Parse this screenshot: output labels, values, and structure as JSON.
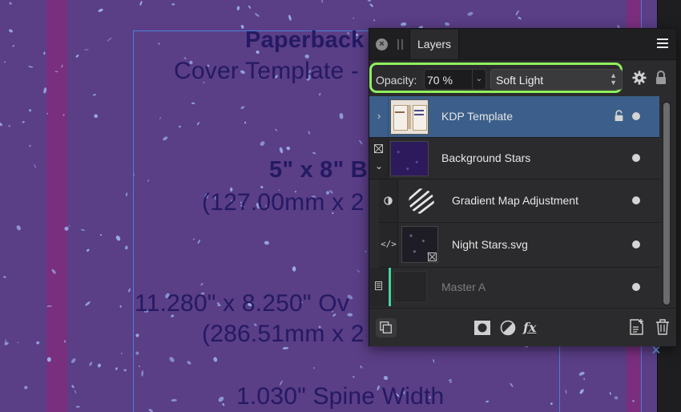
{
  "document": {
    "lines": [
      {
        "id": "title",
        "text": "Paperback"
      },
      {
        "id": "subtitle",
        "text": "Cover Template -"
      },
      {
        "id": "trim",
        "text": "5\" x 8\" B"
      },
      {
        "id": "trim_mm",
        "text": "(127.00mm x 2"
      },
      {
        "id": "overall",
        "text": "11.280\" x 8.250\" Ov"
      },
      {
        "id": "overall_mm",
        "text": "(286.51mm x 2"
      },
      {
        "id": "spine",
        "text": "1.030\" Spine Width"
      }
    ]
  },
  "colors": {
    "canvas": "#5a3e86",
    "bleed": "#7a2f7e",
    "guide": "#4a80d8",
    "star": "#9db3f0",
    "highlight": "#8ff05d",
    "selected_row": "#3b5f8a"
  },
  "panel": {
    "tab_label": "Layers",
    "close_icon": "close-icon",
    "menu_icon": "hamburger-menu-icon",
    "opacity_label": "Opacity:",
    "opacity_value": "70 %",
    "blend_mode": "Soft Light",
    "layers": [
      {
        "name": "KDP Template",
        "selected": true,
        "locked": true,
        "expanded": false,
        "thumbnail": "template-thumbnail"
      },
      {
        "name": "Background Stars",
        "selected": false,
        "locked": false,
        "expanded": true,
        "thumbnail": "stars-thumbnail"
      },
      {
        "name": "Gradient Map Adjustment",
        "selected": false,
        "child": true,
        "thumbnail": "gradient-map-icon"
      },
      {
        "name": "Night Stars.svg",
        "selected": false,
        "child": true,
        "thumbnail": "night-stars-thumbnail"
      },
      {
        "name": "Master A",
        "selected": false,
        "dimmed": true,
        "thumbnail": "master-page-thumbnail"
      }
    ],
    "bottom_tools": [
      "arrange-icon",
      "mask-icon",
      "adjustment-icon",
      "fx-icon",
      "add-layer-icon",
      "trash-icon"
    ]
  }
}
